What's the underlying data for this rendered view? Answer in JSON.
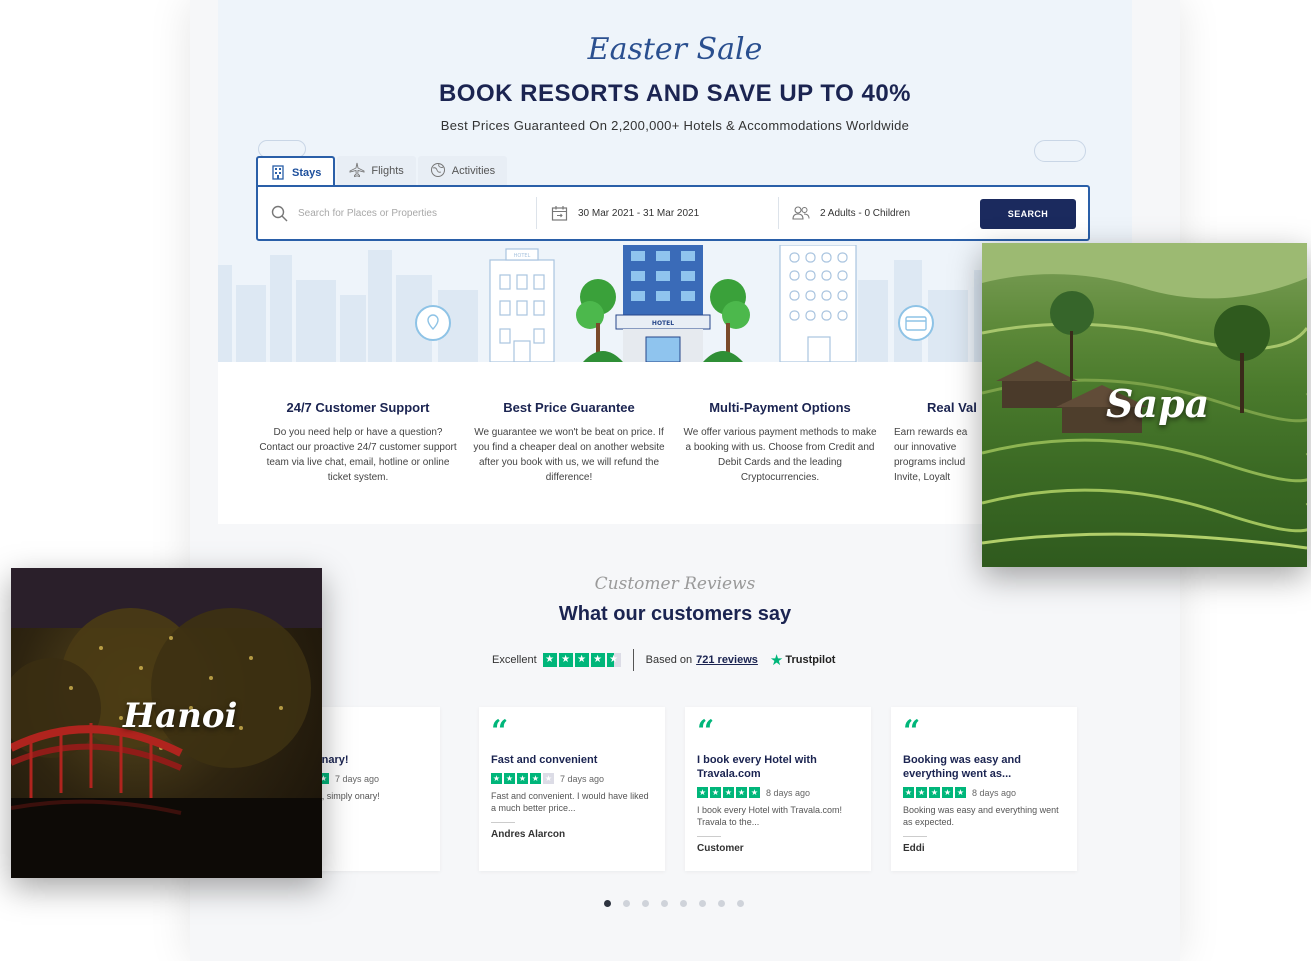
{
  "hero": {
    "easter": "Easter Sale",
    "headline": "BOOK RESORTS AND SAVE UP TO 40%",
    "subline": "Best Prices Guaranteed On 2,200,000+ Hotels & Accommodations Worldwide"
  },
  "tabs": [
    {
      "label": "Stays",
      "icon": "hotel-icon",
      "active": true
    },
    {
      "label": "Flights",
      "icon": "plane-icon",
      "active": false
    },
    {
      "label": "Activities",
      "icon": "globe-icon",
      "active": false
    }
  ],
  "search": {
    "placeholder": "Search for Places or Properties",
    "dates": "30 Mar 2021 - 31 Mar 2021",
    "guests": "2 Adults - 0 Children",
    "button": "SEARCH"
  },
  "illustration": {
    "hotel_sign": "HOTEL",
    "hotel_sign_left": "HOTEL"
  },
  "features": [
    {
      "title": "24/7 Customer Support",
      "text": "Do you need help or have a question? Contact our proactive 24/7 customer support team via live chat, email, hotline or online ticket system."
    },
    {
      "title": "Best Price Guarantee",
      "text": "We guarantee we won't be beat on price. If you find a cheaper deal on another website after you book with us, we will refund the difference!"
    },
    {
      "title": "Multi-Payment Options",
      "text": "We offer various payment methods to make a booking with us. Choose from Credit and Debit Cards and the leading Cryptocurrencies."
    },
    {
      "title": "Real Val",
      "text": "Earn rewards ea our innovative programs includ Invite, Loyalt"
    }
  ],
  "reviews": {
    "label": "Customer Reviews",
    "title": "What our customers say",
    "excellent": "Excellent",
    "based_on": "Based on",
    "count_link": "721 reviews",
    "trustpilot": "Trustpilot",
    "overall_rating": 4.5,
    "cards": [
      {
        "title": "y revolutionary!",
        "age": "7 days ago",
        "text": "nt + cashback, simply onary!",
        "author": "ner",
        "rating": 5
      },
      {
        "title": "Fast and convenient",
        "age": "7 days ago",
        "text": "Fast and convenient. I would have liked a much better price...",
        "author": "Andres Alarcon",
        "rating": 4
      },
      {
        "title": "I book every Hotel with Travala.com",
        "age": "8 days ago",
        "text": "I book every Hotel with Travala.com! Travala to the...",
        "author": "Customer",
        "rating": 5
      },
      {
        "title": "Booking was easy and everything went as...",
        "age": "8 days ago",
        "text": "Booking was easy and everything went as expected.",
        "author": "Eddi",
        "rating": 5
      }
    ],
    "pages": 8,
    "active_page": 1
  },
  "photos": {
    "sapa": "Sapa",
    "hanoi": "Hanoi"
  },
  "colors": {
    "brand_navy": "#1b2451",
    "accent_blue": "#2a5fa8",
    "trustpilot_green": "#00b67a"
  }
}
